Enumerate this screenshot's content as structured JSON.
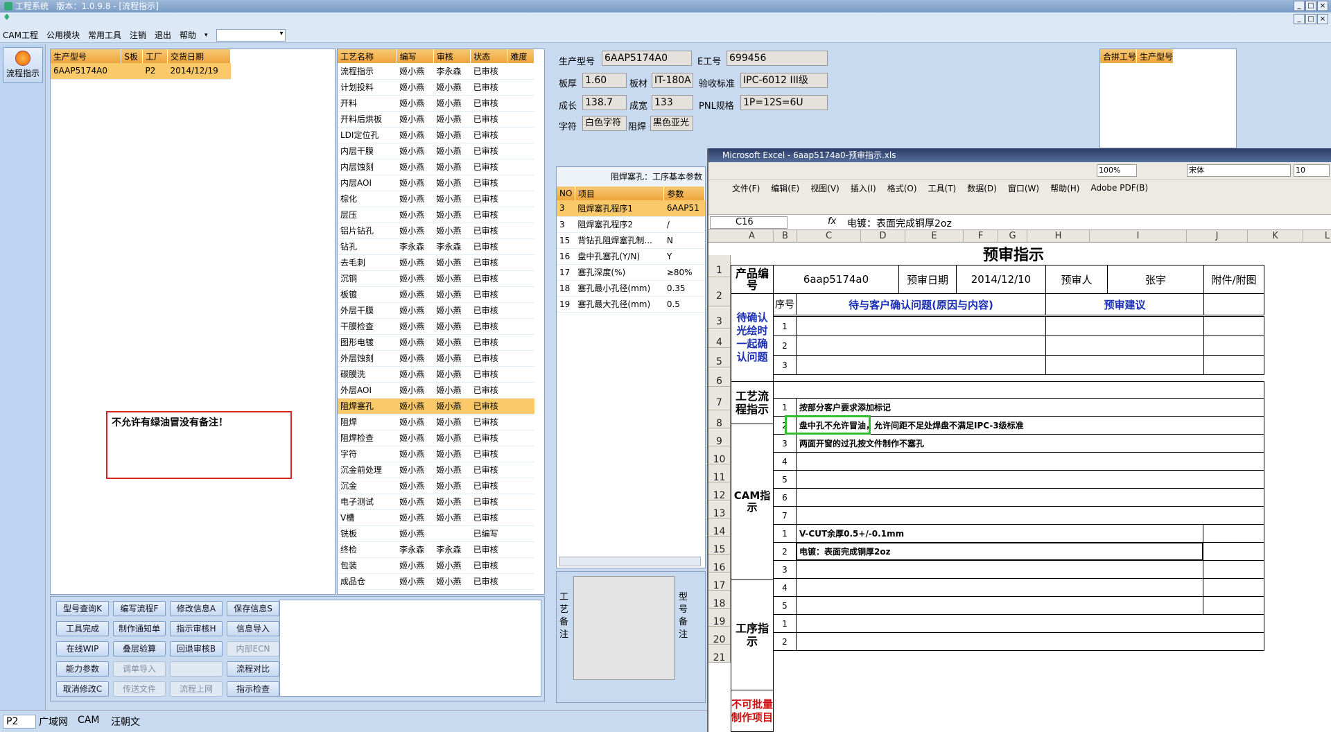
{
  "window": {
    "title": "工程系统",
    "version": "版本：1.0.9.8 - [流程指示]"
  },
  "menu": [
    "CAM工程",
    "公用模块",
    "常用工具",
    "注销",
    "退出",
    "帮助"
  ],
  "side": {
    "flow_label": "流程指示"
  },
  "orders": {
    "headers": [
      "生产型号",
      "S板",
      "工厂",
      "交货日期"
    ],
    "rows": [
      [
        "6AAP5174A0",
        "",
        "P2",
        "2014/12/19"
      ]
    ]
  },
  "note": "不允许有绿油冒没有备注！",
  "processes": {
    "headers": [
      "工艺名称",
      "编写",
      "审核",
      "状态",
      "难度"
    ],
    "rows": [
      [
        "流程指示",
        "姬小燕",
        "李永森",
        "已审核"
      ],
      [
        "计划投料",
        "姬小燕",
        "姬小燕",
        "已审核"
      ],
      [
        "开料",
        "姬小燕",
        "姬小燕",
        "已审核"
      ],
      [
        "开料后烘板",
        "姬小燕",
        "姬小燕",
        "已审核"
      ],
      [
        "LDI定位孔",
        "姬小燕",
        "姬小燕",
        "已审核"
      ],
      [
        "内层干膜",
        "姬小燕",
        "姬小燕",
        "已审核"
      ],
      [
        "内层蚀刻",
        "姬小燕",
        "姬小燕",
        "已审核"
      ],
      [
        "内层AOI",
        "姬小燕",
        "姬小燕",
        "已审核"
      ],
      [
        "棕化",
        "姬小燕",
        "姬小燕",
        "已审核"
      ],
      [
        "层压",
        "姬小燕",
        "姬小燕",
        "已审核"
      ],
      [
        "铝片钻孔",
        "姬小燕",
        "姬小燕",
        "已审核"
      ],
      [
        "钻孔",
        "李永森",
        "李永森",
        "已审核"
      ],
      [
        "去毛刺",
        "姬小燕",
        "姬小燕",
        "已审核"
      ],
      [
        "沉铜",
        "姬小燕",
        "姬小燕",
        "已审核"
      ],
      [
        "板镀",
        "姬小燕",
        "姬小燕",
        "已审核"
      ],
      [
        "外层干膜",
        "姬小燕",
        "姬小燕",
        "已审核"
      ],
      [
        "干膜检查",
        "姬小燕",
        "姬小燕",
        "已审核"
      ],
      [
        "图形电镀",
        "姬小燕",
        "姬小燕",
        "已审核"
      ],
      [
        "外层蚀刻",
        "姬小燕",
        "姬小燕",
        "已审核"
      ],
      [
        "碳膜洗",
        "姬小燕",
        "姬小燕",
        "已审核"
      ],
      [
        "外层AOI",
        "姬小燕",
        "姬小燕",
        "已审核"
      ],
      [
        "阻焊塞孔",
        "姬小燕",
        "姬小燕",
        "已审核"
      ],
      [
        "阻焊",
        "姬小燕",
        "姬小燕",
        "已审核"
      ],
      [
        "阻焊检查",
        "姬小燕",
        "姬小燕",
        "已审核"
      ],
      [
        "字符",
        "姬小燕",
        "姬小燕",
        "已审核"
      ],
      [
        "沉金前处理",
        "姬小燕",
        "姬小燕",
        "已审核"
      ],
      [
        "沉金",
        "姬小燕",
        "姬小燕",
        "已审核"
      ],
      [
        "电子测试",
        "姬小燕",
        "姬小燕",
        "已审核"
      ],
      [
        "V槽",
        "姬小燕",
        "姬小燕",
        "已审核"
      ],
      [
        "铣板",
        "姬小燕",
        "",
        "已编写"
      ],
      [
        "终检",
        "李永森",
        "李永森",
        "已审核"
      ],
      [
        "包装",
        "姬小燕",
        "姬小燕",
        "已审核"
      ],
      [
        "成品仓",
        "姬小燕",
        "姬小燕",
        "已审核"
      ]
    ],
    "selected": 21
  },
  "buttons": [
    [
      "型号查询K",
      "编写流程F",
      "修改信息A",
      "保存信息S"
    ],
    [
      "工具完成",
      "制作通知单",
      "指示审核H",
      "信息导入"
    ],
    [
      "在线WIP",
      "叠层验算",
      "回退审核B",
      "内部ECN"
    ],
    [
      "能力参数",
      "调单导入",
      "",
      "流程对比"
    ],
    [
      "取消修改C",
      "传送文件",
      "流程上网",
      "指示检查"
    ]
  ],
  "info": {
    "model_label": "生产型号",
    "model": "6AAP5174A0",
    "e_label": "E工号",
    "e_no": "699456",
    "thick_label": "板厚",
    "thick": "1.60",
    "mat_label": "板材",
    "mat": "IT-180A",
    "std_label": "验收标准",
    "std": "IPC-6012 III级",
    "len_label": "成长",
    "len": "138.7",
    "wid_label": "成宽",
    "wid": "133",
    "pnl_label": "PNL规格",
    "pnl": "1P=12S=6U",
    "char_label": "字符",
    "char": "白色字符",
    "mask_label": "阻焊",
    "mask": "黑色亚光"
  },
  "merge": {
    "headers": [
      "合拼工号",
      "生产型号"
    ]
  },
  "params": {
    "title": "阻焊塞孔：工序基本参数",
    "headers": [
      "NO",
      "项目",
      "参数"
    ],
    "rows": [
      [
        "3",
        "阻焊塞孔程序1",
        "6AAP51"
      ],
      [
        "3",
        "阻焊塞孔程序2",
        "/"
      ],
      [
        "15",
        "背钻孔阻焊塞孔制...",
        "N"
      ],
      [
        "16",
        "盘中孔塞孔(Y/N)",
        "Y"
      ],
      [
        "17",
        "塞孔深度(%)",
        "≥80%"
      ],
      [
        "18",
        "塞孔最小孔径(mm)",
        "0.35"
      ],
      [
        "19",
        "塞孔最大孔径(mm)",
        "0.5"
      ]
    ]
  },
  "remarks": {
    "left": "工艺备注",
    "right": "型号备注"
  },
  "excel": {
    "title": "Microsoft Excel - 6aap5174a0-预审指示.xls",
    "menu": [
      "文件(F)",
      "编辑(E)",
      "视图(V)",
      "插入(I)",
      "格式(O)",
      "工具(T)",
      "数据(D)",
      "窗口(W)",
      "帮助(H)",
      "Adobe PDF(B)"
    ],
    "zoom": "100%",
    "font": "宋体",
    "size": "10",
    "cellref": "C16",
    "formula": "电镀：表面完成铜厚2oz",
    "cols": [
      "A",
      "B",
      "C",
      "D",
      "E",
      "F",
      "G",
      "H",
      "I",
      "J",
      "K",
      "L"
    ],
    "heading": "预审指示",
    "product_label": "产品编号",
    "product": "6aap5174a0",
    "date_label": "预审日期",
    "date": "2014/12/10",
    "reviewer_label": "预审人",
    "reviewer": "张宇",
    "attach_label": "附件/附图",
    "seq": "序号",
    "pending_label": "待确认光绘时一起确认问题",
    "issue": "待与客户确认问题(原因与内容)",
    "advice": "预审建议",
    "flow_label": "工艺流程指示",
    "cam_label": "CAM指示",
    "proc_label": "工序指示",
    "forbid_label": "不可批量制作项目",
    "cam": [
      "按部分客户要求添加标记",
      "盘中孔不允许冒油，允许间距不足处焊盘不满足IPC-3级标准",
      "两面开窗的过孔按文件制作不塞孔"
    ],
    "proc": [
      "V-CUT余厚0.5+/-0.1mm",
      "电镀：表面完成铜厚2oz"
    ]
  },
  "taskbar": [
    "P2",
    "广域网",
    "CAM",
    "汪朝文"
  ]
}
